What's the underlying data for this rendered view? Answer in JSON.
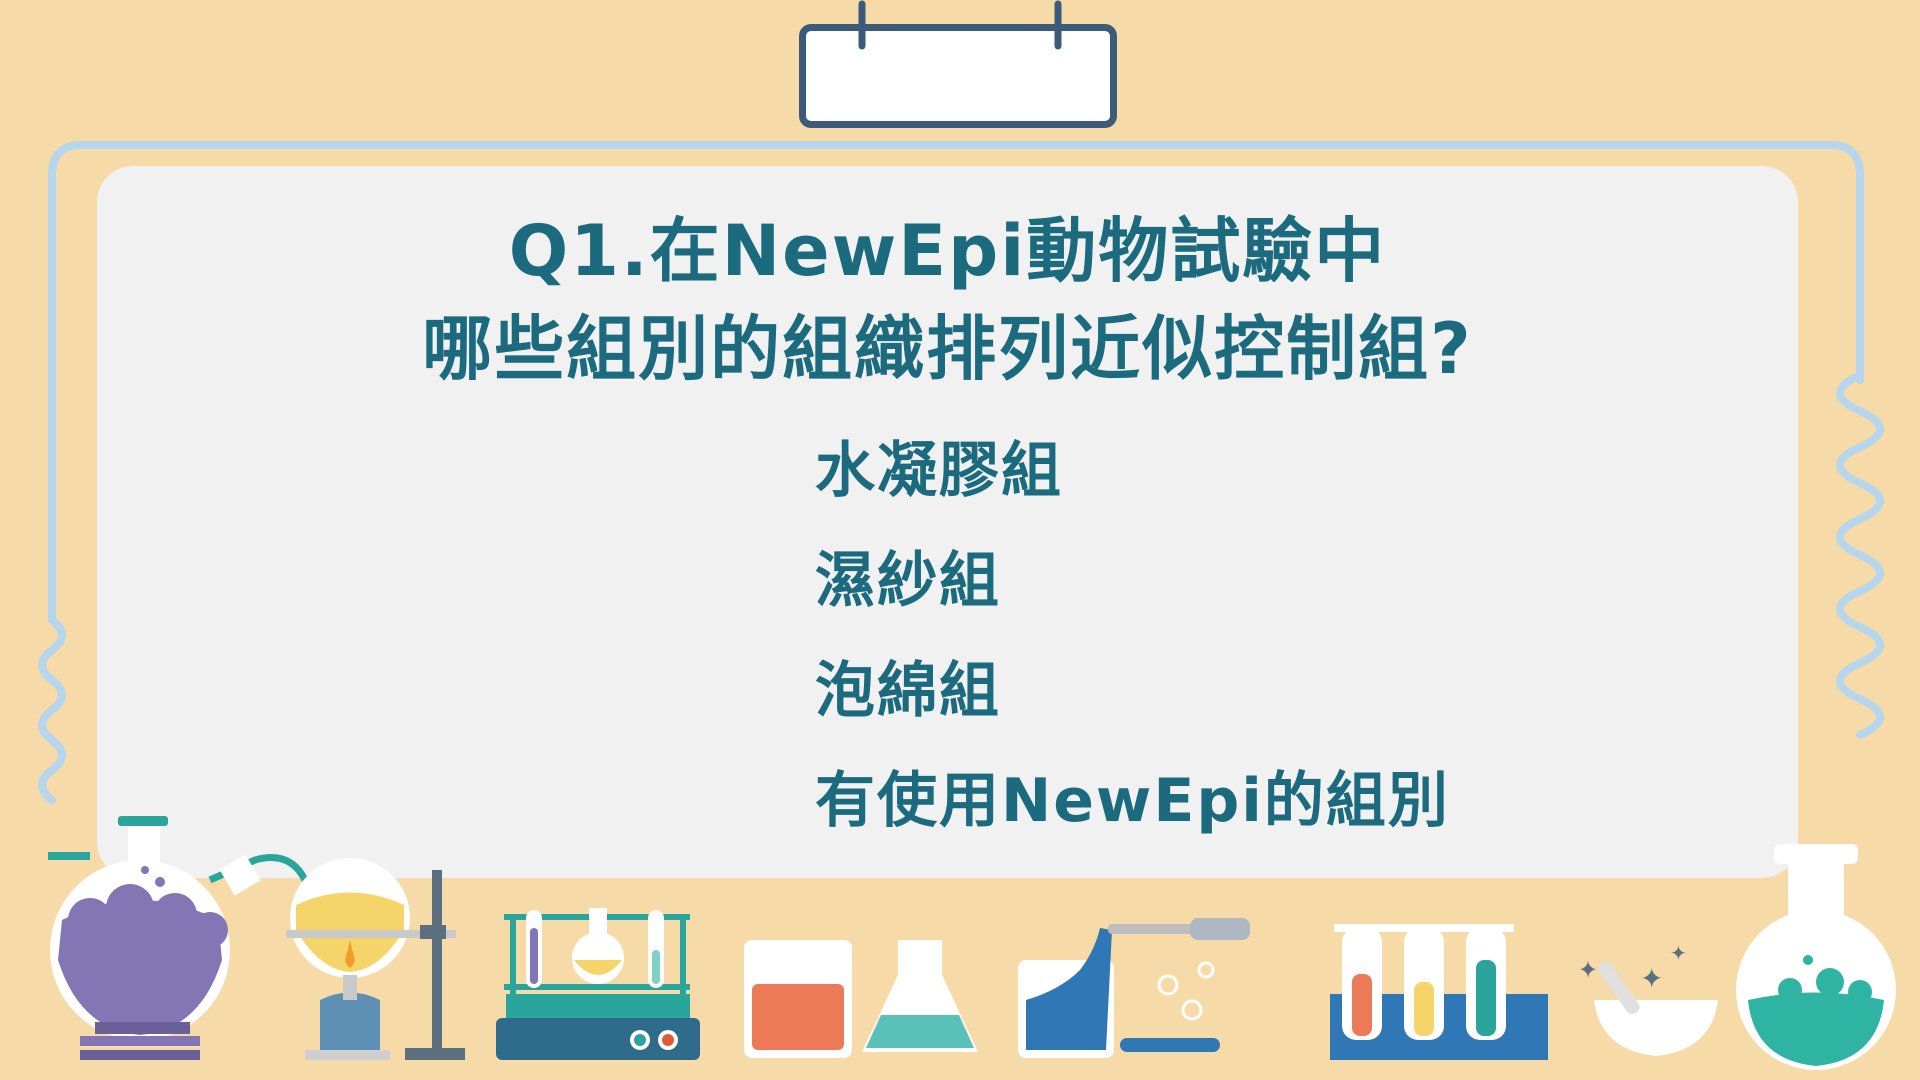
{
  "question": {
    "title_line_1": "Q1.在NewEpi動物試驗中",
    "title_line_2": "哪些組別的組織排列近似控制組?"
  },
  "options": [
    "水凝膠組",
    "濕紗組",
    "泡綿組",
    "有使用NewEpi的組別"
  ],
  "colors": {
    "background": "#f6dba8",
    "board": "#f1f1f1",
    "text": "#1b6a7e",
    "frame_tube": "#b5d6ec",
    "clip": "#3c5a7a"
  },
  "icons": [
    "round-bottom-flask-icon",
    "bunsen-burner-icon",
    "retort-stand-icon",
    "test-tube-rack-icon",
    "beaker-icon",
    "erlenmeyer-flask-icon",
    "pouring-beaker-icon",
    "dropper-icon",
    "test-tubes-icon",
    "mortar-pestle-icon",
    "volumetric-flask-icon"
  ]
}
